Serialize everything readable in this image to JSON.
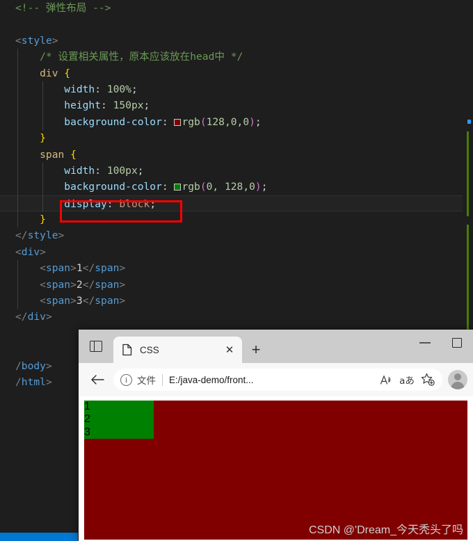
{
  "editor": {
    "lines": [
      {
        "indent": 0,
        "guides": [],
        "segments": [
          {
            "cls": "t-comment",
            "text": "<!-- 弹性布局 -->"
          }
        ]
      },
      {
        "indent": 0,
        "guides": [],
        "segments": []
      },
      {
        "indent": 0,
        "guides": [],
        "segments": [
          {
            "cls": "t-punct",
            "text": "<"
          },
          {
            "cls": "t-tag",
            "text": "style"
          },
          {
            "cls": "t-punct",
            "text": ">"
          }
        ]
      },
      {
        "indent": 1,
        "guides": [
          "g1"
        ],
        "segments": [
          {
            "cls": "t-comment",
            "text": "    /* 设置相关属性，原本应该放在head中 */"
          }
        ]
      },
      {
        "indent": 1,
        "guides": [
          "g1"
        ],
        "segments": [
          {
            "cls": "t-sel",
            "text": "    div "
          },
          {
            "cls": "t-brace",
            "text": "{"
          }
        ]
      },
      {
        "indent": 2,
        "guides": [
          "g1",
          "g2"
        ],
        "segments": [
          {
            "cls": "t-prop",
            "text": "        width"
          },
          {
            "cls": "t-plain",
            "text": ": "
          },
          {
            "cls": "t-num",
            "text": "100%"
          },
          {
            "cls": "t-plain",
            "text": ";"
          }
        ]
      },
      {
        "indent": 2,
        "guides": [
          "g1",
          "g2"
        ],
        "segments": [
          {
            "cls": "t-prop",
            "text": "        height"
          },
          {
            "cls": "t-plain",
            "text": ": "
          },
          {
            "cls": "t-num",
            "text": "150px"
          },
          {
            "cls": "t-plain",
            "text": ";"
          }
        ]
      },
      {
        "indent": 2,
        "guides": [
          "g1",
          "g2"
        ],
        "swatch": "#800000",
        "segments": [
          {
            "cls": "t-prop",
            "text": "        background-color"
          },
          {
            "cls": "t-plain",
            "text": ": "
          },
          {
            "cls": "__swatch__",
            "text": ""
          },
          {
            "cls": "t-val",
            "text": "rgb"
          },
          {
            "cls": "t-paren",
            "text": "("
          },
          {
            "cls": "t-val",
            "text": "128,0,0"
          },
          {
            "cls": "t-paren",
            "text": ")"
          },
          {
            "cls": "t-plain",
            "text": ";"
          }
        ]
      },
      {
        "indent": 1,
        "guides": [
          "g1"
        ],
        "segments": [
          {
            "cls": "t-brace",
            "text": "    }"
          }
        ]
      },
      {
        "indent": 1,
        "guides": [
          "g1"
        ],
        "segments": [
          {
            "cls": "t-sel",
            "text": "    span "
          },
          {
            "cls": "t-brace",
            "text": "{"
          }
        ]
      },
      {
        "indent": 2,
        "guides": [
          "g1",
          "g2"
        ],
        "segments": [
          {
            "cls": "t-prop",
            "text": "        width"
          },
          {
            "cls": "t-plain",
            "text": ": "
          },
          {
            "cls": "t-num",
            "text": "100px"
          },
          {
            "cls": "t-plain",
            "text": ";"
          }
        ]
      },
      {
        "indent": 2,
        "guides": [
          "g1",
          "g2"
        ],
        "swatch": "#008000",
        "segments": [
          {
            "cls": "t-prop",
            "text": "        background-color"
          },
          {
            "cls": "t-plain",
            "text": ": "
          },
          {
            "cls": "__swatch__",
            "text": ""
          },
          {
            "cls": "t-val",
            "text": "rgb"
          },
          {
            "cls": "t-paren",
            "text": "("
          },
          {
            "cls": "t-val",
            "text": "0, 128,0"
          },
          {
            "cls": "t-paren",
            "text": ")"
          },
          {
            "cls": "t-plain",
            "text": ";"
          }
        ]
      },
      {
        "indent": 2,
        "guides": [
          "g1",
          "g2"
        ],
        "current": true,
        "segments": [
          {
            "cls": "t-prop",
            "text": "        display"
          },
          {
            "cls": "t-plain",
            "text": ": "
          },
          {
            "cls": "t-valstr",
            "text": "block"
          },
          {
            "cls": "t-plain",
            "text": ";"
          }
        ]
      },
      {
        "indent": 1,
        "guides": [
          "g1"
        ],
        "segments": [
          {
            "cls": "t-brace",
            "text": "    }"
          }
        ]
      },
      {
        "indent": 0,
        "guides": [],
        "segments": [
          {
            "cls": "t-punct",
            "text": "</"
          },
          {
            "cls": "t-tag",
            "text": "style"
          },
          {
            "cls": "t-punct",
            "text": ">"
          }
        ]
      },
      {
        "indent": 0,
        "guides": [],
        "segments": [
          {
            "cls": "t-punct",
            "text": "<"
          },
          {
            "cls": "t-tag",
            "text": "div"
          },
          {
            "cls": "t-punct",
            "text": ">"
          }
        ]
      },
      {
        "indent": 1,
        "guides": [
          "g1"
        ],
        "segments": [
          {
            "cls": "t-punct",
            "text": "    <"
          },
          {
            "cls": "t-tag",
            "text": "span"
          },
          {
            "cls": "t-punct",
            "text": ">"
          },
          {
            "cls": "t-text",
            "text": "1"
          },
          {
            "cls": "t-punct",
            "text": "</"
          },
          {
            "cls": "t-tag",
            "text": "span"
          },
          {
            "cls": "t-punct",
            "text": ">"
          }
        ]
      },
      {
        "indent": 1,
        "guides": [
          "g1"
        ],
        "segments": [
          {
            "cls": "t-punct",
            "text": "    <"
          },
          {
            "cls": "t-tag",
            "text": "span"
          },
          {
            "cls": "t-punct",
            "text": ">"
          },
          {
            "cls": "t-text",
            "text": "2"
          },
          {
            "cls": "t-punct",
            "text": "</"
          },
          {
            "cls": "t-tag",
            "text": "span"
          },
          {
            "cls": "t-punct",
            "text": ">"
          }
        ]
      },
      {
        "indent": 1,
        "guides": [
          "g1"
        ],
        "segments": [
          {
            "cls": "t-punct",
            "text": "    <"
          },
          {
            "cls": "t-tag",
            "text": "span"
          },
          {
            "cls": "t-punct",
            "text": ">"
          },
          {
            "cls": "t-text",
            "text": "3"
          },
          {
            "cls": "t-punct",
            "text": "</"
          },
          {
            "cls": "t-tag",
            "text": "span"
          },
          {
            "cls": "t-punct",
            "text": ">"
          }
        ]
      },
      {
        "indent": 0,
        "guides": [],
        "segments": [
          {
            "cls": "t-punct",
            "text": "</"
          },
          {
            "cls": "t-tag",
            "text": "div"
          },
          {
            "cls": "t-punct",
            "text": ">"
          }
        ]
      },
      {
        "indent": 0,
        "guides": [],
        "segments": []
      },
      {
        "indent": 0,
        "guides": [],
        "segments": []
      },
      {
        "indent": 0,
        "guides": [],
        "segments": [
          {
            "cls": "t-punct",
            "text": "/"
          },
          {
            "cls": "t-tag",
            "text": "body"
          },
          {
            "cls": "t-punct",
            "text": ">"
          }
        ]
      },
      {
        "indent": 0,
        "guides": [],
        "segments": [
          {
            "cls": "t-punct",
            "text": "/"
          },
          {
            "cls": "t-tag",
            "text": "html"
          },
          {
            "cls": "t-punct",
            "text": ">"
          }
        ]
      }
    ],
    "annotation": {
      "target_text": "display: block;",
      "color": "#fe0000"
    },
    "ruler": {
      "modified_color": "#487e02",
      "marker_color": "#3794ff"
    },
    "statusbar_color": "#0078d4"
  },
  "browser": {
    "sidebar_button": "sidebar-toggle",
    "tab": {
      "title": "CSS",
      "favicon": "document-icon",
      "close_label": "✕"
    },
    "newtab_label": "+",
    "window_controls": {
      "minimize": "−",
      "maximize": "□"
    },
    "toolbar": {
      "back_label": "←",
      "url_scheme": "文件",
      "url": "E:/java-demo/front...",
      "read_aloud": "A",
      "translate": "aあ",
      "favorite": "☆",
      "profile": "avatar"
    },
    "page": {
      "div_background": "#800000",
      "span_background": "#008000",
      "spans": [
        "1",
        "2",
        "3"
      ],
      "watermark": "CSDN @'Dream_今天秃头了吗"
    }
  }
}
